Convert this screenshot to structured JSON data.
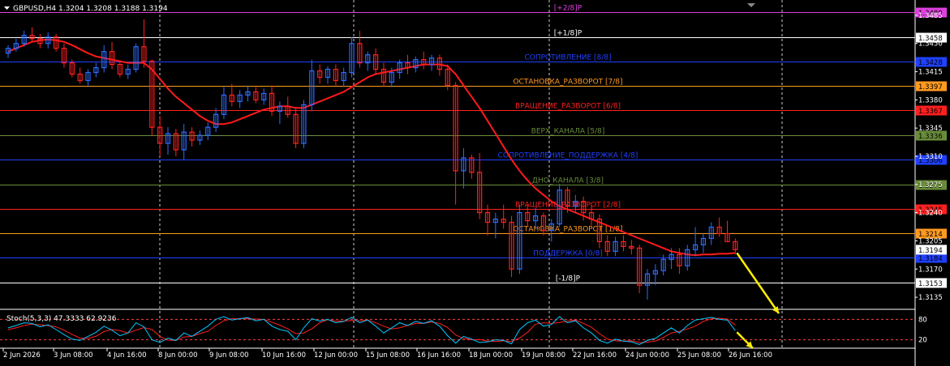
{
  "header": {
    "title": "GBPUSD,H4 1.3204 1.3208 1.3188 1.3194"
  },
  "indicator": {
    "title": "Stoch(5,3,3) 47.3333 62.9236",
    "levels": [
      "80",
      "20"
    ],
    "main_color": "#00c8ff",
    "signal_color": "#ff2020"
  },
  "colors": {
    "bull_candle": "#2f6bff",
    "bear_candle": "#ff2020",
    "ma_line": "#ff1a1a",
    "arrow": "#ffee00",
    "background": "#000000",
    "grid": "#ffffff"
  },
  "murrey_levels": [
    {
      "label": "[+2/8]P",
      "price": 1.3489,
      "tag": "1.3489",
      "color": "#e040e0"
    },
    {
      "label": "[+1/8]P",
      "price": 1.3458,
      "tag": "1.3458",
      "color": "#ffffff"
    },
    {
      "label": "СОПРОТИВЛЕНИЕ [8/8]",
      "price": 1.3428,
      "tag": "1.3428",
      "color": "#2040ff"
    },
    {
      "label": "ОСТАНОВКА_РАЗВОРОТ [7/8]",
      "price": 1.3397,
      "tag": "1.3397",
      "color": "#ff9a20"
    },
    {
      "label": "ВРАЩЕНИЕ_РАЗВОРОТ [6/8]",
      "price": 1.3367,
      "tag": "1.3367",
      "color": "#ff2020"
    },
    {
      "label": "ВЕРХ_КАНАЛА [5/8]",
      "price": 1.3336,
      "tag": "1.3336",
      "color": "#6a8c3a"
    },
    {
      "label": "СОПРОТИВЛЕНИЕ_ПОДДЕРЖКА [4/8]",
      "price": 1.3306,
      "tag": "1.3306",
      "color": "#2040ff"
    },
    {
      "label": "ДНО_КАНАЛА [3/8]",
      "price": 1.3275,
      "tag": "1.3275",
      "color": "#6a8c3a"
    },
    {
      "label": "ВРАЩЕНИЕ_РАЗВОРОТ [2/8]",
      "price": 1.3245,
      "tag": "1.3245",
      "color": "#ff2020"
    },
    {
      "label": "ОСТАНОВКА_РАЗВОРОТ [1/8]",
      "price": 1.3214,
      "tag": "1.3214",
      "color": "#ff9a20"
    },
    {
      "label": "ПОДДЕРЖКА [0/8]",
      "price": 1.3184,
      "tag": "1.3184",
      "color": "#2040ff"
    },
    {
      "label": "[-1/8]P",
      "price": 1.3153,
      "tag": "1.3153",
      "color": "#ffffff"
    }
  ],
  "price_axis": {
    "ticks": [
      "1.3485",
      "1.3450",
      "1.3415",
      "1.3380",
      "1.3345",
      "1.3310",
      "1.3275",
      "1.3240",
      "1.3205",
      "1.3170",
      "1.3135"
    ],
    "current": "1.3194"
  },
  "time_axis": {
    "labels": [
      "2 Jun 2026",
      "3 Jun 08:00",
      "4 Jun 16:00",
      "8 Jun 00:00",
      "9 Jun 08:00",
      "10 Jun 16:00",
      "12 Jun 00:00",
      "15 Jun 08:00",
      "16 Jun 16:00",
      "18 Jun 00:00",
      "19 Jun 08:00",
      "22 Jun 16:00",
      "24 Jun 00:00",
      "25 Jun 08:00",
      "26 Jun 16:00"
    ]
  },
  "chart_data": {
    "type": "candlestick",
    "symbol": "GBPUSD",
    "timeframe": "H4",
    "ylim": [
      1.3122,
      1.35
    ],
    "ohlc": [
      [
        1.3438,
        1.3448,
        1.3432,
        1.3444
      ],
      [
        1.3444,
        1.3456,
        1.344,
        1.345
      ],
      [
        1.345,
        1.3466,
        1.3446,
        1.346
      ],
      [
        1.346,
        1.347,
        1.3452,
        1.3456
      ],
      [
        1.3456,
        1.3462,
        1.3444,
        1.345
      ],
      [
        1.345,
        1.3464,
        1.3444,
        1.3458
      ],
      [
        1.3458,
        1.3462,
        1.344,
        1.3444
      ],
      [
        1.3444,
        1.345,
        1.342,
        1.3426
      ],
      [
        1.3426,
        1.343,
        1.3408,
        1.3412
      ],
      [
        1.3412,
        1.342,
        1.34,
        1.3404
      ],
      [
        1.3404,
        1.3418,
        1.3398,
        1.3414
      ],
      [
        1.3414,
        1.3426,
        1.3408,
        1.342
      ],
      [
        1.342,
        1.3448,
        1.3414,
        1.344
      ],
      [
        1.344,
        1.3452,
        1.3418,
        1.3424
      ],
      [
        1.3424,
        1.3428,
        1.3408,
        1.3412
      ],
      [
        1.3412,
        1.3424,
        1.3406,
        1.3418
      ],
      [
        1.3418,
        1.345,
        1.3414,
        1.3446
      ],
      [
        1.3446,
        1.348,
        1.342,
        1.3428
      ],
      [
        1.3428,
        1.343,
        1.3336,
        1.3346
      ],
      [
        1.3346,
        1.336,
        1.331,
        1.3326
      ],
      [
        1.3326,
        1.3346,
        1.3312,
        1.3338
      ],
      [
        1.3338,
        1.3344,
        1.331,
        1.3318
      ],
      [
        1.3318,
        1.335,
        1.3306,
        1.334
      ],
      [
        1.334,
        1.3346,
        1.3322,
        1.333
      ],
      [
        1.333,
        1.3342,
        1.3324,
        1.3336
      ],
      [
        1.3336,
        1.3352,
        1.333,
        1.3346
      ],
      [
        1.3346,
        1.337,
        1.334,
        1.3362
      ],
      [
        1.3362,
        1.3396,
        1.3356,
        1.3386
      ],
      [
        1.3386,
        1.34,
        1.3372,
        1.3378
      ],
      [
        1.3378,
        1.3392,
        1.337,
        1.3386
      ],
      [
        1.3386,
        1.3398,
        1.3378,
        1.339
      ],
      [
        1.339,
        1.3396,
        1.3376,
        1.338
      ],
      [
        1.338,
        1.3394,
        1.3374,
        1.3388
      ],
      [
        1.3388,
        1.3398,
        1.336,
        1.3366
      ],
      [
        1.3366,
        1.3378,
        1.335,
        1.3372
      ],
      [
        1.3372,
        1.3384,
        1.3358,
        1.3362
      ],
      [
        1.3362,
        1.337,
        1.332,
        1.3326
      ],
      [
        1.3326,
        1.338,
        1.332,
        1.3374
      ],
      [
        1.3374,
        1.343,
        1.3366,
        1.3416
      ],
      [
        1.3416,
        1.3424,
        1.34,
        1.3408
      ],
      [
        1.3408,
        1.3422,
        1.34,
        1.3418
      ],
      [
        1.3418,
        1.3424,
        1.3398,
        1.3404
      ],
      [
        1.3404,
        1.342,
        1.3396,
        1.3414
      ],
      [
        1.3414,
        1.3458,
        1.3408,
        1.345
      ],
      [
        1.345,
        1.3466,
        1.342,
        1.3426
      ],
      [
        1.3426,
        1.344,
        1.3416,
        1.3436
      ],
      [
        1.3436,
        1.3444,
        1.3412,
        1.3418
      ],
      [
        1.3418,
        1.3426,
        1.3396,
        1.3402
      ],
      [
        1.3402,
        1.342,
        1.3396,
        1.3414
      ],
      [
        1.3414,
        1.343,
        1.3406,
        1.3426
      ],
      [
        1.3426,
        1.3436,
        1.3412,
        1.342
      ],
      [
        1.342,
        1.3434,
        1.3414,
        1.343
      ],
      [
        1.343,
        1.344,
        1.3418,
        1.3424
      ],
      [
        1.3424,
        1.3436,
        1.3416,
        1.3432
      ],
      [
        1.3432,
        1.3436,
        1.341,
        1.3418
      ],
      [
        1.3418,
        1.3424,
        1.3392,
        1.3398
      ],
      [
        1.3398,
        1.3402,
        1.325,
        1.3292
      ],
      [
        1.3292,
        1.332,
        1.327,
        1.3308
      ],
      [
        1.3308,
        1.3312,
        1.3282,
        1.329
      ],
      [
        1.329,
        1.3314,
        1.3232,
        1.324
      ],
      [
        1.324,
        1.325,
        1.3212,
        1.3228
      ],
      [
        1.3228,
        1.324,
        1.3208,
        1.3232
      ],
      [
        1.3232,
        1.325,
        1.322,
        1.3228
      ],
      [
        1.3228,
        1.3236,
        1.316,
        1.317
      ],
      [
        1.317,
        1.325,
        1.3164,
        1.324
      ],
      [
        1.324,
        1.325,
        1.3222,
        1.323
      ],
      [
        1.323,
        1.3246,
        1.322,
        1.3236
      ],
      [
        1.3236,
        1.324,
        1.3212,
        1.3218
      ],
      [
        1.3218,
        1.3232,
        1.3204,
        1.3226
      ],
      [
        1.3226,
        1.3276,
        1.3222,
        1.3268
      ],
      [
        1.3268,
        1.3272,
        1.324,
        1.3248
      ],
      [
        1.3248,
        1.3262,
        1.324,
        1.3254
      ],
      [
        1.3254,
        1.326,
        1.323,
        1.324
      ],
      [
        1.324,
        1.325,
        1.3224,
        1.3232
      ],
      [
        1.3232,
        1.3238,
        1.3196,
        1.3204
      ],
      [
        1.3204,
        1.3212,
        1.3186,
        1.3192
      ],
      [
        1.3192,
        1.321,
        1.3186,
        1.3204
      ],
      [
        1.3204,
        1.3212,
        1.3192,
        1.3198
      ],
      [
        1.3198,
        1.3206,
        1.3188,
        1.3196
      ],
      [
        1.3196,
        1.32,
        1.314,
        1.315
      ],
      [
        1.315,
        1.317,
        1.3132,
        1.3164
      ],
      [
        1.3164,
        1.3176,
        1.315,
        1.3168
      ],
      [
        1.3168,
        1.3188,
        1.3162,
        1.3182
      ],
      [
        1.3182,
        1.3196,
        1.317,
        1.3188
      ],
      [
        1.3188,
        1.3196,
        1.3164,
        1.3174
      ],
      [
        1.3174,
        1.32,
        1.3168,
        1.3194
      ],
      [
        1.3194,
        1.3222,
        1.3186,
        1.32
      ],
      [
        1.32,
        1.3214,
        1.319,
        1.3208
      ],
      [
        1.3208,
        1.3228,
        1.32,
        1.3222
      ],
      [
        1.3222,
        1.3234,
        1.321,
        1.3214
      ],
      [
        1.3214,
        1.323,
        1.3204,
        1.3204
      ],
      [
        1.3204,
        1.3208,
        1.3188,
        1.3194
      ]
    ],
    "ma": [
      1.344,
      1.3444,
      1.3448,
      1.3452,
      1.3454,
      1.3455,
      1.3454,
      1.3452,
      1.3448,
      1.3443,
      1.3438,
      1.3434,
      1.3432,
      1.343,
      1.3428,
      1.3426,
      1.3426,
      1.3426,
      1.3418,
      1.3406,
      1.3394,
      1.3384,
      1.3376,
      1.3368,
      1.336,
      1.3354,
      1.335,
      1.335,
      1.3352,
      1.3356,
      1.336,
      1.3364,
      1.3368,
      1.337,
      1.3372,
      1.3372,
      1.337,
      1.337,
      1.3374,
      1.3378,
      1.3382,
      1.3386,
      1.339,
      1.3396,
      1.3402,
      1.3408,
      1.3412,
      1.3414,
      1.3416,
      1.3418,
      1.342,
      1.3422,
      1.3424,
      1.3424,
      1.3424,
      1.3422,
      1.3412,
      1.3398,
      1.3384,
      1.337,
      1.3354,
      1.3338,
      1.3322,
      1.3306,
      1.3292,
      1.328,
      1.327,
      1.3262,
      1.3254,
      1.3248,
      1.3244,
      1.324,
      1.3236,
      1.3232,
      1.3228,
      1.3224,
      1.322,
      1.3216,
      1.3212,
      1.3208,
      1.3204,
      1.32,
      1.3196,
      1.3192,
      1.319,
      1.3188,
      1.3187,
      1.3188,
      1.3188,
      1.3189,
      1.3189,
      1.319
    ],
    "stoch_main": [
      55,
      62,
      70,
      68,
      58,
      64,
      50,
      35,
      22,
      18,
      30,
      42,
      60,
      48,
      32,
      40,
      70,
      58,
      20,
      12,
      25,
      18,
      40,
      30,
      45,
      60,
      80,
      88,
      78,
      82,
      85,
      76,
      80,
      60,
      50,
      45,
      20,
      55,
      82,
      75,
      80,
      70,
      74,
      86,
      70,
      78,
      60,
      40,
      55,
      70,
      62,
      74,
      68,
      76,
      60,
      32,
      10,
      30,
      22,
      12,
      14,
      20,
      18,
      8,
      50,
      70,
      78,
      60,
      65,
      88,
      70,
      76,
      55,
      40,
      18,
      10,
      22,
      16,
      14,
      6,
      18,
      24,
      40,
      55,
      40,
      62,
      78,
      82,
      86,
      80,
      78,
      47
    ],
    "stoch_signal": [
      50,
      55,
      62,
      66,
      64,
      62,
      58,
      48,
      36,
      25,
      24,
      30,
      44,
      50,
      47,
      40,
      48,
      56,
      50,
      30,
      19,
      18,
      28,
      30,
      38,
      45,
      62,
      76,
      82,
      82,
      82,
      81,
      80,
      72,
      63,
      52,
      38,
      40,
      52,
      70,
      79,
      75,
      75,
      77,
      76,
      78,
      70,
      60,
      52,
      55,
      62,
      68,
      68,
      72,
      68,
      56,
      34,
      24,
      20,
      21,
      16,
      15,
      17,
      15,
      25,
      42,
      66,
      70,
      68,
      71,
      75,
      78,
      68,
      57,
      38,
      22,
      17,
      16,
      17,
      12,
      13,
      16,
      27,
      40,
      45,
      52,
      60,
      74,
      82,
      83,
      81,
      63
    ]
  }
}
